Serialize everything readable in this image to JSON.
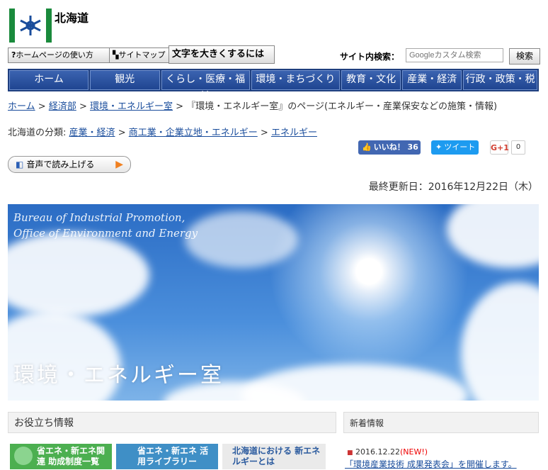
{
  "header": {
    "pref_name": "北海道",
    "tool_buttons": {
      "guide": "ホームページの使い方",
      "sitemap": "サイトマップ",
      "fontsize": "文字を大きくするには"
    },
    "search": {
      "label": "サイト内検索：",
      "placeholder": "Googleカスタム検索",
      "button": "検索"
    }
  },
  "gnav": [
    "ホーム",
    "観光",
    "くらし・医療・福祉",
    "環境・まちづくり",
    "教育・文化",
    "産業・経済",
    "行政・政策・税"
  ],
  "breadcrumb": {
    "links": [
      "ホーム",
      "経済部",
      "環境・エネルギー室"
    ],
    "sep": ">",
    "current": "『環境・エネルギー室』のページ(エネルギー・産業保安などの施策・情報)"
  },
  "classification": {
    "label": "北海道の分類:",
    "links": [
      "産業・経済",
      "商工業・企業立地・エネルギー",
      "エネルギー"
    ]
  },
  "social": {
    "like": "いいね！ 36",
    "tweet": "ツイート",
    "gplus": "G+1",
    "gplus_count": "0"
  },
  "tts": {
    "label": "音声で読み上げる"
  },
  "updated": "最終更新日：2016年12月22日（木）",
  "hero": {
    "en_line1": "Bureau of Industrial Promotion,",
    "en_line2": "Office of Environment and Energy",
    "jp_title": "環境・エネルギー室"
  },
  "sections": {
    "useful": "お役立ち情報",
    "news": "新着情報"
  },
  "banners": [
    "省エネ・新エネ関連 助成制度一覧",
    "省エネ・新エネ 活用ライブラリー",
    "北海道における 新エネルギーとは"
  ],
  "news": {
    "date": "2016.12.22",
    "new_label": "(NEW!)",
    "link": "「環境産業技術 成果発表会」を開催します。"
  },
  "colors": {
    "nav_bg": "#1e3e7e",
    "logo_green": "#1a8a3c",
    "link": "#1a4d9c"
  }
}
